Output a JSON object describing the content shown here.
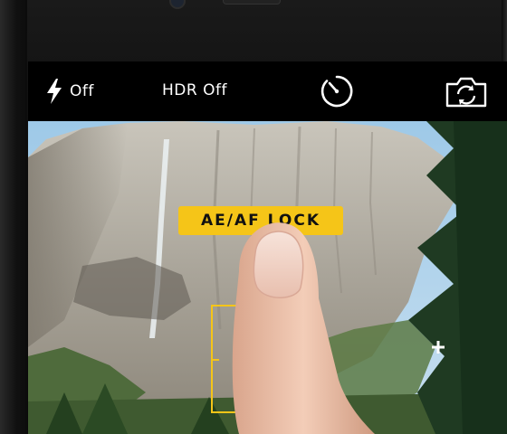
{
  "camera": {
    "topbar": {
      "flash": {
        "icon": "flash-bolt-icon",
        "label": "Off"
      },
      "hdr": {
        "label": "HDR Off"
      },
      "timer": {
        "icon": "timer-icon"
      },
      "switch_camera": {
        "icon": "camera-switch-icon"
      }
    },
    "viewfinder": {
      "lock_label": "AE/AF LOCK",
      "focus_marker": "focus-square",
      "exposure_marker": "plus-icon"
    },
    "colors": {
      "accent": "#f5c518",
      "bar_background": "#000000",
      "text": "#ffffff"
    }
  }
}
